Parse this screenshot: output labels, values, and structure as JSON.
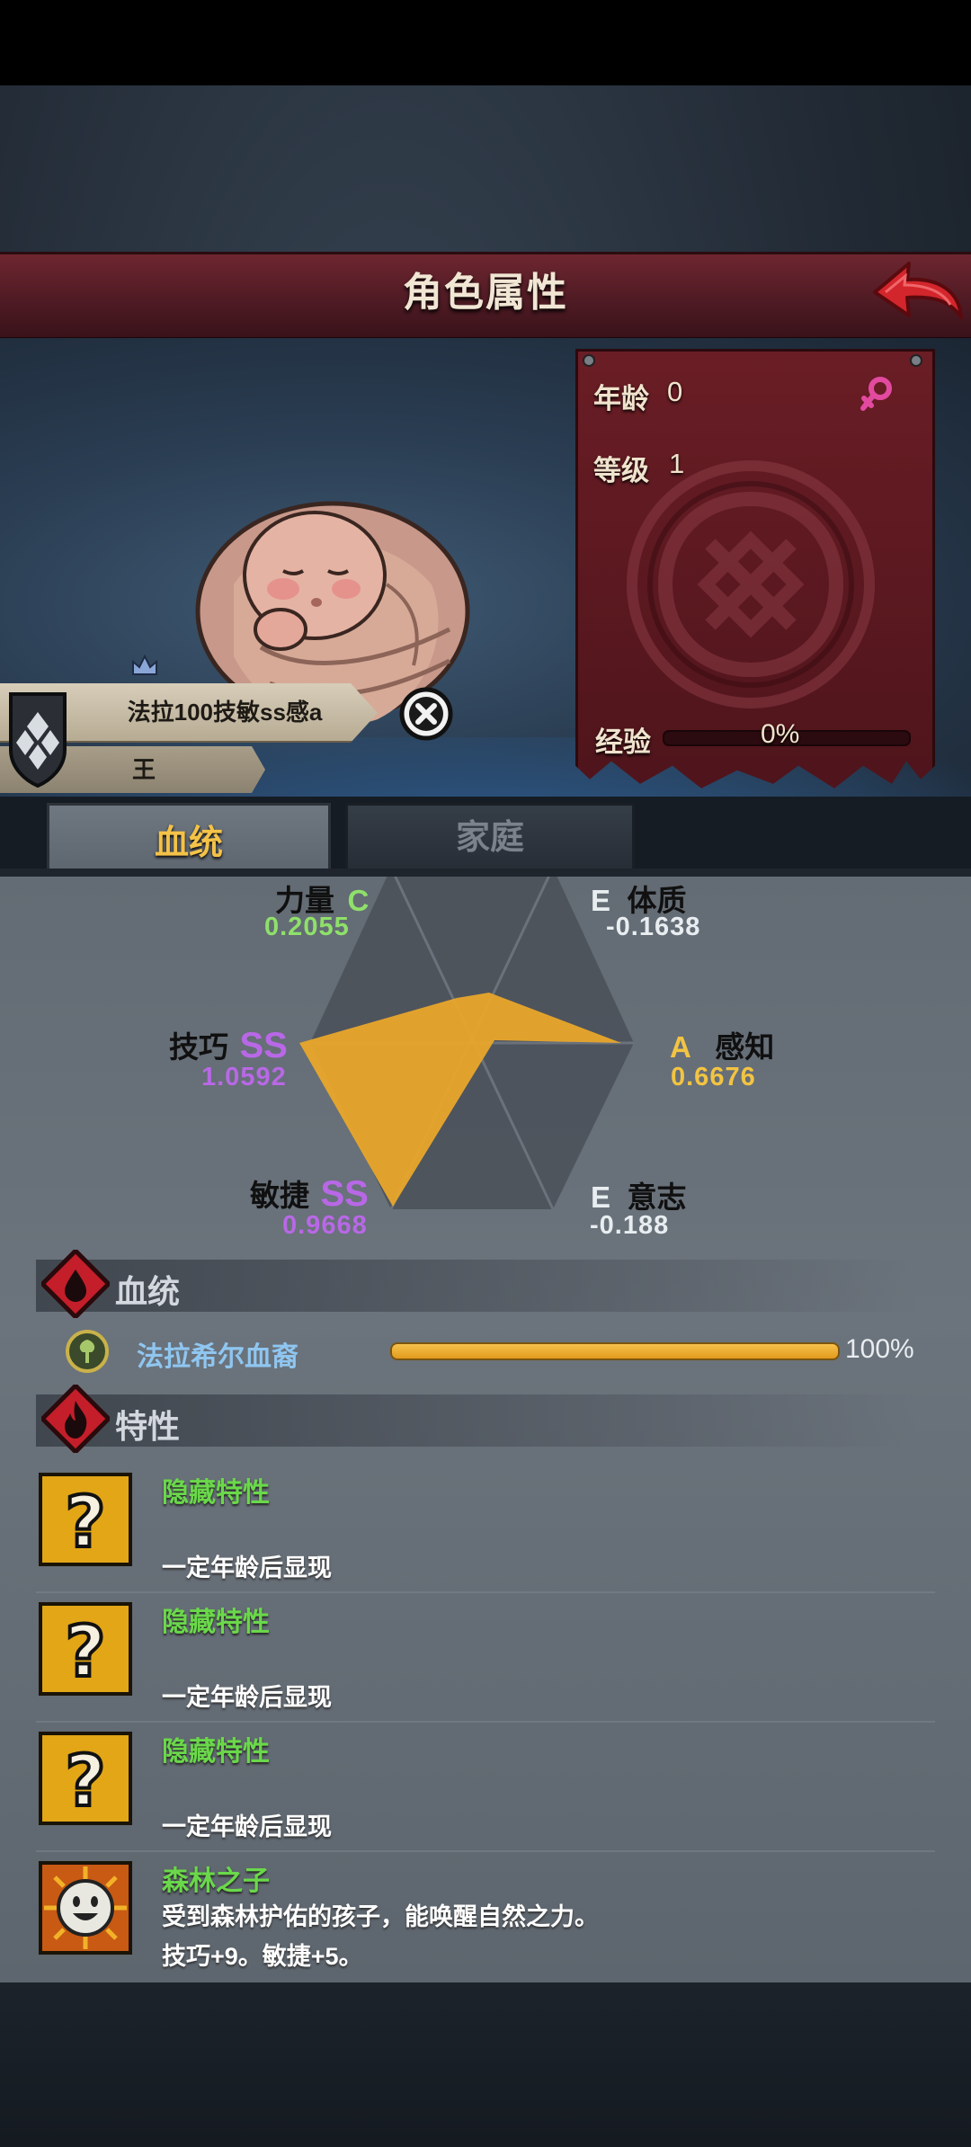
{
  "header": {
    "title": "角色属性"
  },
  "character": {
    "name": "法拉100技敏ss感a",
    "subtitle": "王",
    "age_label": "年龄",
    "age_value": "0",
    "level_label": "等级",
    "level_value": "1",
    "exp_label": "经验",
    "exp_value": "0%"
  },
  "tabs": [
    {
      "label": "血统",
      "active": true
    },
    {
      "label": "家庭",
      "active": false
    }
  ],
  "attributes": {
    "strength": {
      "name": "力量",
      "grade": "C",
      "value": "0.2055",
      "color": "#8fe06a"
    },
    "constitution": {
      "name": "体质",
      "grade": "E",
      "value": "-0.1638",
      "color": "#e8edf0"
    },
    "skill": {
      "name": "技巧",
      "grade": "SS",
      "value": "1.0592",
      "color": "#b868e6"
    },
    "perception": {
      "name": "感知",
      "grade": "A",
      "value": "0.6676",
      "color": "#f2c442"
    },
    "agility": {
      "name": "敏捷",
      "grade": "SS",
      "value": "0.9668",
      "color": "#b868e6"
    },
    "will": {
      "name": "意志",
      "grade": "E",
      "value": "-0.188",
      "color": "#e8edf0"
    }
  },
  "bloodline_section": {
    "title": "血统",
    "entry_name": "法拉希尔血裔",
    "entry_percent": "100%",
    "fill": 1.0
  },
  "traits_section": {
    "title": "特性",
    "items": [
      {
        "name": "隐藏特性",
        "desc1": "一定年龄后显现",
        "desc2": "",
        "icon": "question-icon"
      },
      {
        "name": "隐藏特性",
        "desc1": "一定年龄后显现",
        "desc2": "",
        "icon": "question-icon"
      },
      {
        "name": "隐藏特性",
        "desc1": "一定年龄后显现",
        "desc2": "",
        "icon": "question-icon"
      },
      {
        "name": "森林之子",
        "desc1": "受到森林护佑的孩子，能唤醒自然之力。",
        "desc2": "技巧+9。敏捷+5。",
        "icon": "smiley-sun-icon"
      }
    ]
  },
  "colors": {
    "header": "#5a1e27",
    "panel": "#5e1820",
    "accent_gold": "#e9a72a",
    "trait_green": "#6ad84a"
  }
}
